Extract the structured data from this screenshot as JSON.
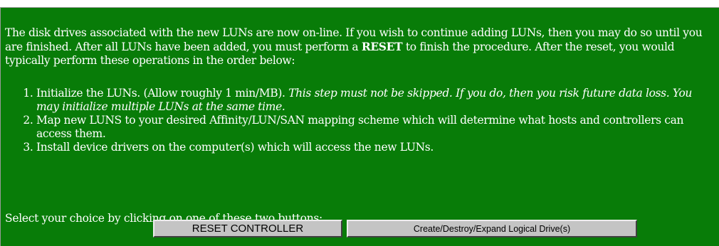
{
  "intro": {
    "text_before": "The disk drives associated with the new LUNs are now on-line. If you wish to continue adding LUNs, then you may do so until you are finished. After all LUNs have been added, you must perform a ",
    "bold": "RESET",
    "text_after": " to finish the procedure. After the reset, you would typically perform these operations in the order below:"
  },
  "steps": [
    {
      "text": "Initialize the LUNs. (Allow roughly 1 min/MB). ",
      "italic": "This step must not be skipped. If you do, then you risk future data loss. You may initialize multiple LUNs at the same time."
    },
    {
      "text": "Map new LUNS to your desired Affinity/LUN/SAN mapping scheme which will determine what hosts and controllers can access them."
    },
    {
      "text": "Install device drivers on the computer(s) which will access the new LUNs."
    }
  ],
  "choice_prompt": "Select your choice by clicking on one of these two buttons:",
  "buttons": {
    "reset": "RESET CONTROLLER",
    "create": "Create/Destroy/Expand Logical Drive(s)"
  },
  "colors": {
    "background": "#087c08",
    "text": "#ffffff",
    "button_face": "#c4c4c4"
  }
}
